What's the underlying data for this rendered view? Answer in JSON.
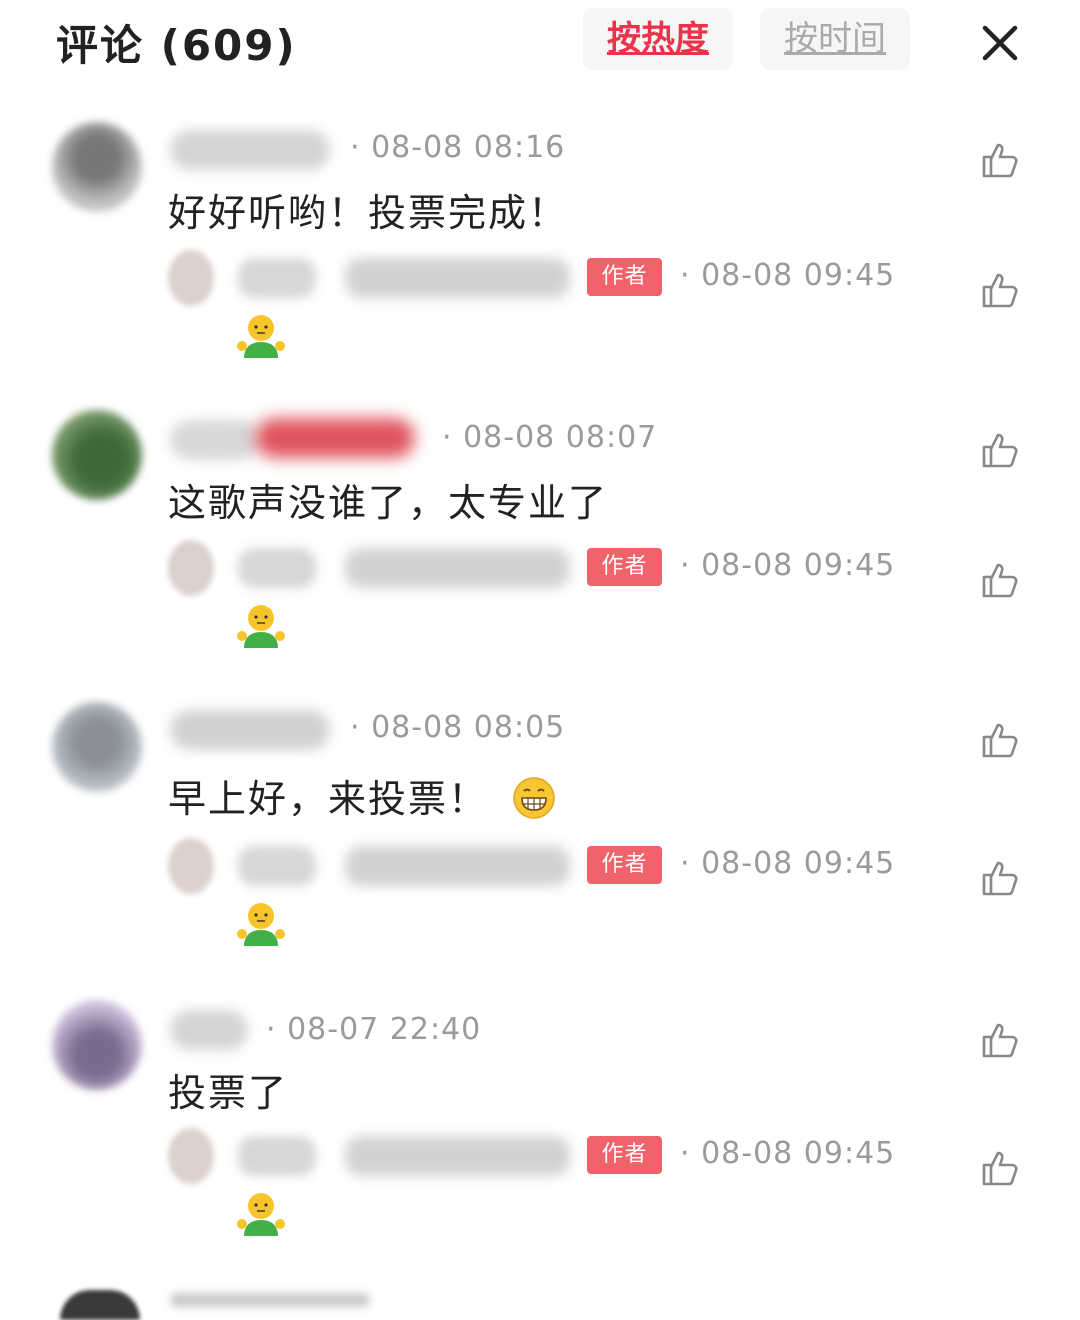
{
  "header": {
    "title": "评论 (609)",
    "sort_hot_label": "按热度",
    "sort_time_label": "按时间",
    "close_icon": "close-icon"
  },
  "comments": [
    {
      "timestamp": "· 08-08 08:16",
      "text": "好好听哟！投票完成！",
      "reply": {
        "badge": "作者",
        "timestamp": "· 08-08 09:45",
        "emoji": "person-shrug-emoji"
      }
    },
    {
      "timestamp": "· 08-08 08:07",
      "text": "这歌声没谁了，太专业了",
      "reply": {
        "badge": "作者",
        "timestamp": "· 08-08 09:45",
        "emoji": "person-shrug-emoji"
      }
    },
    {
      "timestamp": "· 08-08 08:05",
      "text": "早上好，来投票！",
      "text_emoji": "grin-emoji",
      "reply": {
        "badge": "作者",
        "timestamp": "· 08-08 09:45",
        "emoji": "person-shrug-emoji"
      }
    },
    {
      "timestamp": "· 08-07 22:40",
      "text": "投票了",
      "reply": {
        "badge": "作者",
        "timestamp": "· 08-08 09:45",
        "emoji": "person-shrug-emoji"
      }
    }
  ],
  "colors": {
    "accent": "#e8334a",
    "badge": "#f0636b",
    "meta": "#9a9a9a",
    "text": "#222222"
  }
}
